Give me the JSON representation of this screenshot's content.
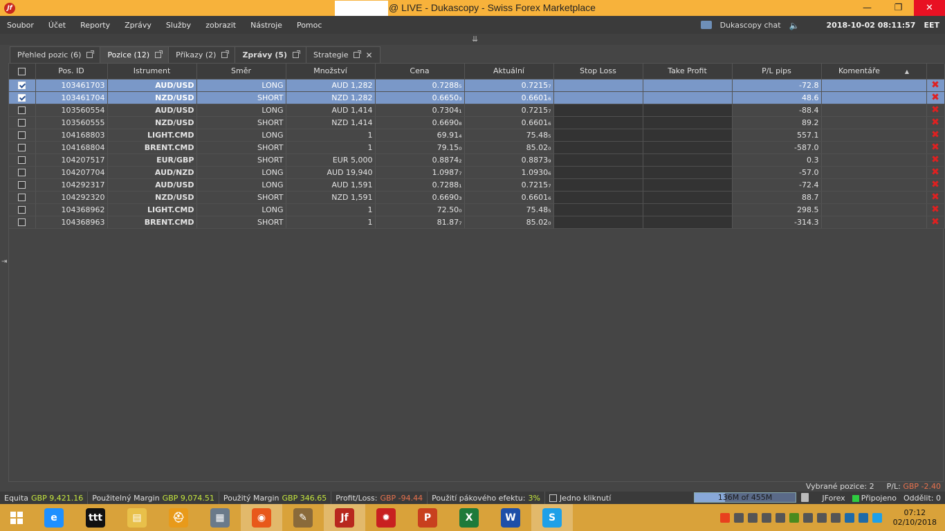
{
  "window": {
    "title": "@ LIVE - Dukascopy - Swiss Forex Marketplace",
    "app_icon": "jf-logo-icon",
    "minimize": "—",
    "maximize": "❐",
    "close": "✕"
  },
  "menu": [
    "Soubor",
    "Účet",
    "Reporty",
    "Zprávy",
    "Služby",
    "zobrazit",
    "Nástroje",
    "Pomoc"
  ],
  "header_right": {
    "chat_label": "Dukascopy chat",
    "datetime": "2018-10-02 08:11:57",
    "timezone": "EET"
  },
  "tabs": [
    {
      "label": "Přehled pozic (6)",
      "active": false,
      "bold": false,
      "closable": false
    },
    {
      "label": "Pozice (12)",
      "active": true,
      "bold": false,
      "closable": false
    },
    {
      "label": "Příkazy (2)",
      "active": false,
      "bold": false,
      "closable": false
    },
    {
      "label": "Zprávy (5)",
      "active": false,
      "bold": true,
      "closable": false
    },
    {
      "label": "Strategie",
      "active": false,
      "bold": false,
      "closable": true
    }
  ],
  "columns": [
    "",
    "Pos. ID",
    "Istrument",
    "Směr",
    "Množství",
    "Cena",
    "Aktuální",
    "Stop Loss",
    "Take Profit",
    "P/L pips",
    "Komentáře",
    ""
  ],
  "rows": [
    {
      "selected": true,
      "id": "103461703",
      "instrument": "AUD/USD",
      "dir": "LONG",
      "qty": "AUD 1,282",
      "price": "0.7288₅",
      "current": "0.7215₇",
      "sl": "",
      "tp": "",
      "pl": "-72.8",
      "comment": ""
    },
    {
      "selected": true,
      "id": "103461704",
      "instrument": "NZD/USD",
      "dir": "SHORT",
      "qty": "NZD 1,282",
      "price": "0.6650₃",
      "current": "0.6601₆",
      "sl": "",
      "tp": "",
      "pl": "48.6",
      "comment": ""
    },
    {
      "selected": false,
      "id": "103560554",
      "instrument": "AUD/USD",
      "dir": "LONG",
      "qty": "AUD 1,414",
      "price": "0.7304₁",
      "current": "0.7215₇",
      "sl": "",
      "tp": "",
      "pl": "-88.4",
      "comment": ""
    },
    {
      "selected": false,
      "id": "103560555",
      "instrument": "NZD/USD",
      "dir": "SHORT",
      "qty": "NZD 1,414",
      "price": "0.6690₈",
      "current": "0.6601₆",
      "sl": "",
      "tp": "",
      "pl": "89.2",
      "comment": ""
    },
    {
      "selected": false,
      "id": "104168803",
      "instrument": "LIGHT.CMD",
      "dir": "LONG",
      "qty": "1",
      "price": "69.91₄",
      "current": "75.48₅",
      "sl": "",
      "tp": "",
      "pl": "557.1",
      "comment": ""
    },
    {
      "selected": false,
      "id": "104168804",
      "instrument": "BRENT.CMD",
      "dir": "SHORT",
      "qty": "1",
      "price": "79.15₀",
      "current": "85.02₀",
      "sl": "",
      "tp": "",
      "pl": "-587.0",
      "comment": ""
    },
    {
      "selected": false,
      "id": "104207517",
      "instrument": "EUR/GBP",
      "dir": "SHORT",
      "qty": "EUR 5,000",
      "price": "0.8874₂",
      "current": "0.8873₉",
      "sl": "",
      "tp": "",
      "pl": "0.3",
      "comment": ""
    },
    {
      "selected": false,
      "id": "104207704",
      "instrument": "AUD/NZD",
      "dir": "LONG",
      "qty": "AUD 19,940",
      "price": "1.0987₇",
      "current": "1.0930₆",
      "sl": "",
      "tp": "",
      "pl": "-57.0",
      "comment": ""
    },
    {
      "selected": false,
      "id": "104292317",
      "instrument": "AUD/USD",
      "dir": "LONG",
      "qty": "AUD 1,591",
      "price": "0.7288₁",
      "current": "0.7215₇",
      "sl": "",
      "tp": "",
      "pl": "-72.4",
      "comment": ""
    },
    {
      "selected": false,
      "id": "104292320",
      "instrument": "NZD/USD",
      "dir": "SHORT",
      "qty": "NZD 1,591",
      "price": "0.6690₃",
      "current": "0.6601₆",
      "sl": "",
      "tp": "",
      "pl": "88.7",
      "comment": ""
    },
    {
      "selected": false,
      "id": "104368962",
      "instrument": "LIGHT.CMD",
      "dir": "LONG",
      "qty": "1",
      "price": "72.50₀",
      "current": "75.48₅",
      "sl": "",
      "tp": "",
      "pl": "298.5",
      "comment": ""
    },
    {
      "selected": false,
      "id": "104368963",
      "instrument": "BRENT.CMD",
      "dir": "SHORT",
      "qty": "1",
      "price": "81.87₇",
      "current": "85.02₀",
      "sl": "",
      "tp": "",
      "pl": "-314.3",
      "comment": ""
    }
  ],
  "selection_summary": {
    "selected_label": "Vybrané pozice:",
    "selected_count": "2",
    "pl_label": "P/L:",
    "pl_value": "GBP -2.40"
  },
  "status": {
    "equity_label": "Equita",
    "equity_value": "GBP 9,421.16",
    "usable_margin_label": "Použitelný Margin",
    "usable_margin_value": "GBP 9,074.51",
    "used_margin_label": "Použitý Margin",
    "used_margin_value": "GBP 346.65",
    "pl_label": "Profit/Loss:",
    "pl_value": "GBP -94.44",
    "leverage_label": "Použití pákového efektu:",
    "leverage_value": "3%",
    "one_click_label": "Jedno kliknutí",
    "memory": "136M of 455M",
    "memory_fraction": 0.299,
    "platform": "JForex",
    "connected": "Připojeno",
    "detach": "Oddělit: 0"
  },
  "taskbar": {
    "apps": [
      {
        "name": "internet-explorer-icon",
        "glyph": "e",
        "color": "#1e90ff",
        "active": false
      },
      {
        "name": "trading-app-icon",
        "glyph": "ttt",
        "color": "#111111",
        "active": false
      },
      {
        "name": "file-explorer-icon",
        "glyph": "▤",
        "color": "#e8c04a",
        "active": false
      },
      {
        "name": "hardhat-app-icon",
        "glyph": "⛑",
        "color": "#e89a1a",
        "active": false
      },
      {
        "name": "calculator-icon",
        "glyph": "▦",
        "color": "#6a7a8a",
        "active": false
      },
      {
        "name": "firefox-icon",
        "glyph": "◉",
        "color": "#e8581a",
        "active": true
      },
      {
        "name": "paint-icon",
        "glyph": "✎",
        "color": "#8a6a3a",
        "active": false
      },
      {
        "name": "jforex-icon",
        "glyph": "Jf",
        "color": "#b8281e",
        "active": true
      },
      {
        "name": "gear-app-icon",
        "glyph": "✹",
        "color": "#c82020",
        "active": false
      },
      {
        "name": "powerpoint-icon",
        "glyph": "P",
        "color": "#c8401e",
        "active": false
      },
      {
        "name": "excel-icon",
        "glyph": "X",
        "color": "#1e7a3a",
        "active": false
      },
      {
        "name": "word-icon",
        "glyph": "W",
        "color": "#1e4fa8",
        "active": false
      },
      {
        "name": "skype-icon",
        "glyph": "S",
        "color": "#1ea0e8",
        "active": true
      }
    ],
    "time": "07:12",
    "date": "02/10/2018"
  }
}
